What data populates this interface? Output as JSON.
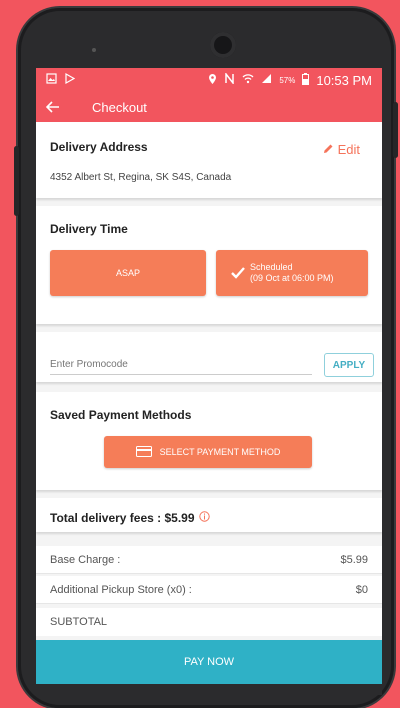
{
  "statusbar": {
    "battery": "57%",
    "time": "10:53 PM"
  },
  "appbar": {
    "title": "Checkout"
  },
  "delivery_address": {
    "heading": "Delivery Address",
    "edit_label": "Edit",
    "address": "4352 Albert St, Regina, SK S4S, Canada"
  },
  "delivery_time": {
    "heading": "Delivery Time",
    "asap_label": "ASAP",
    "scheduled_line1": "Scheduled",
    "scheduled_line2": "(09 Oct at 06:00 PM)"
  },
  "promo": {
    "placeholder": "Enter Promocode",
    "apply_label": "APPLY"
  },
  "payment": {
    "heading": "Saved Payment Methods",
    "select_label": "SELECT PAYMENT METHOD"
  },
  "fees": {
    "total_label": "Total delivery fees : $5.99",
    "rows": [
      {
        "label": "Base Charge :",
        "value": "$5.99"
      },
      {
        "label": "Additional Pickup Store (x0) :",
        "value": "$0"
      },
      {
        "label": "SUBTOTAL",
        "value": ""
      }
    ]
  },
  "pay_now_label": "PAY NOW",
  "colors": {
    "brand": "#f2555e",
    "accent": "#f57d58",
    "pay": "#2fb1c6"
  }
}
